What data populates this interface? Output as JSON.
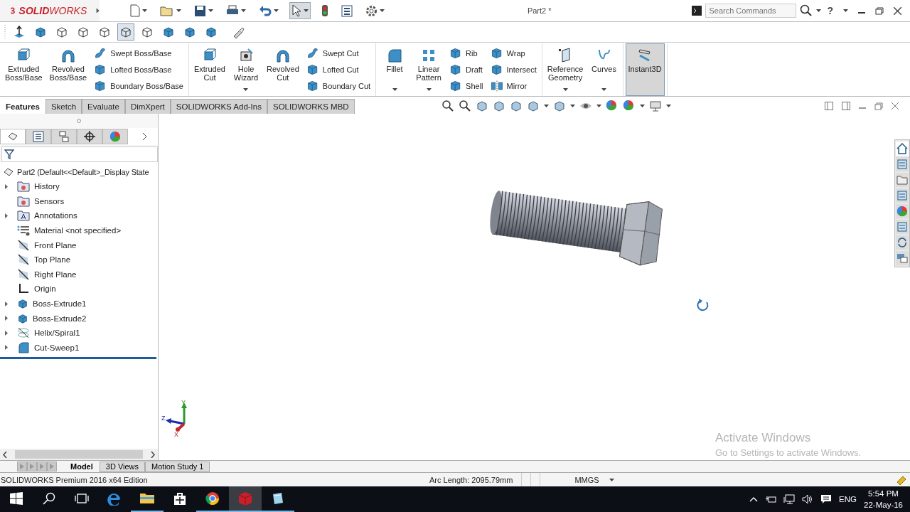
{
  "title_bar": {
    "logo_text": "**SOLID**WORKS",
    "document_title": "Part2 *",
    "search": {
      "placeholder": "Search Commands"
    },
    "help": "?"
  },
  "ribbon": {
    "groups": [
      {
        "items": [
          {
            "kind": "large",
            "label": "Extruded\nBoss/Base",
            "dropdown": false,
            "pressed": false
          },
          {
            "kind": "large",
            "label": "Revolved\nBoss/Base",
            "dropdown": false,
            "pressed": false
          },
          {
            "kind": "column",
            "entries": [
              "Swept Boss/Base",
              "Lofted Boss/Base",
              "Boundary Boss/Base"
            ]
          }
        ]
      },
      {
        "items": [
          {
            "kind": "large",
            "label": "Extruded\nCut",
            "dropdown": false,
            "pressed": false
          },
          {
            "kind": "large",
            "label": "Hole\nWizard",
            "dropdown": true,
            "pressed": false
          },
          {
            "kind": "large",
            "label": "Revolved\nCut",
            "dropdown": false,
            "pressed": false
          },
          {
            "kind": "column",
            "entries": [
              "Swept Cut",
              "Lofted Cut",
              "Boundary Cut"
            ]
          }
        ]
      },
      {
        "items": [
          {
            "kind": "large",
            "label": "Fillet",
            "dropdown": true,
            "pressed": false
          },
          {
            "kind": "large",
            "label": "Linear\nPattern",
            "dropdown": true,
            "pressed": false
          },
          {
            "kind": "column",
            "entries": [
              "Rib",
              "Draft",
              "Shell"
            ]
          },
          {
            "kind": "column",
            "entries": [
              "Wrap",
              "Intersect",
              "Mirror"
            ]
          }
        ]
      },
      {
        "items": [
          {
            "kind": "large",
            "label": "Reference\nGeometry",
            "dropdown": true,
            "pressed": false
          },
          {
            "kind": "large",
            "label": "Curves",
            "dropdown": true,
            "pressed": false
          }
        ]
      },
      {
        "items": [
          {
            "kind": "large",
            "label": "Instant3D",
            "dropdown": false,
            "pressed": true
          }
        ]
      }
    ]
  },
  "command_tabs": [
    {
      "label": "Features",
      "selected": true
    },
    {
      "label": "Sketch",
      "selected": false
    },
    {
      "label": "Evaluate",
      "selected": false
    },
    {
      "label": "DimXpert",
      "selected": false
    },
    {
      "label": "SOLIDWORKS Add-Ins",
      "selected": false
    },
    {
      "label": "SOLIDWORKS MBD",
      "selected": false
    }
  ],
  "panel_tabs": [
    {
      "selected": true
    },
    {
      "selected": false
    },
    {
      "selected": false
    },
    {
      "selected": false
    },
    {
      "selected": false
    }
  ],
  "feature_tree": {
    "root": "Part2  (Default<<Default>_Display State",
    "items": [
      {
        "kind": "history",
        "label": "History",
        "expandable": true
      },
      {
        "kind": "sensor",
        "label": "Sensors",
        "expandable": false
      },
      {
        "kind": "annotation",
        "label": "Annotations",
        "expandable": true
      },
      {
        "kind": "material",
        "label": "Material <not specified>",
        "expandable": false
      },
      {
        "kind": "plane",
        "label": "Front Plane",
        "expandable": false
      },
      {
        "kind": "plane",
        "label": "Top Plane",
        "expandable": false
      },
      {
        "kind": "plane",
        "label": "Right Plane",
        "expandable": false
      },
      {
        "kind": "origin",
        "label": "Origin",
        "expandable": false
      },
      {
        "kind": "extrude",
        "label": "Boss-Extrude1",
        "expandable": true
      },
      {
        "kind": "extrude",
        "label": "Boss-Extrude2",
        "expandable": true
      },
      {
        "kind": "helix",
        "label": "Helix/Spiral1",
        "expandable": true
      },
      {
        "kind": "sweep",
        "label": "Cut-Sweep1",
        "expandable": true
      }
    ]
  },
  "triad": [
    {
      "label": "Y",
      "color": "#2e9a2e"
    },
    {
      "label": "Z",
      "color": "#1f2fa8"
    },
    {
      "label": "X",
      "color": "#c0282a"
    }
  ],
  "task_pane_tabs": [
    {
      "selected": true
    },
    {
      "selected": false
    },
    {
      "selected": false
    },
    {
      "selected": false
    },
    {
      "selected": false
    },
    {
      "selected": false
    },
    {
      "selected": false
    },
    {
      "selected": false
    }
  ],
  "activation_notice": {
    "title": "Activate Windows",
    "message": "Go to Settings to activate Windows."
  },
  "bottom_tabs": [
    {
      "label": "Model",
      "selected": true
    },
    {
      "label": "3D Views",
      "selected": false
    },
    {
      "label": "Motion Study 1",
      "selected": false
    }
  ],
  "status_bar": {
    "edition": "SOLIDWORKS Premium 2016 x64 Edition",
    "arc_length": "Arc Length: 2095.79mm",
    "units": "MMGS"
  },
  "taskbar": {
    "apps": [
      {
        "kind": "edge",
        "running": false,
        "selected": false
      },
      {
        "kind": "explorer",
        "running": true,
        "selected": false
      },
      {
        "kind": "store",
        "running": false,
        "selected": false
      },
      {
        "kind": "chrome",
        "running": true,
        "selected": false
      },
      {
        "kind": "solidworks",
        "running": true,
        "selected": true
      },
      {
        "kind": "notepad",
        "running": true,
        "selected": false
      }
    ],
    "language": "ENG",
    "time": "5:54 PM",
    "date": "22-May-16"
  }
}
